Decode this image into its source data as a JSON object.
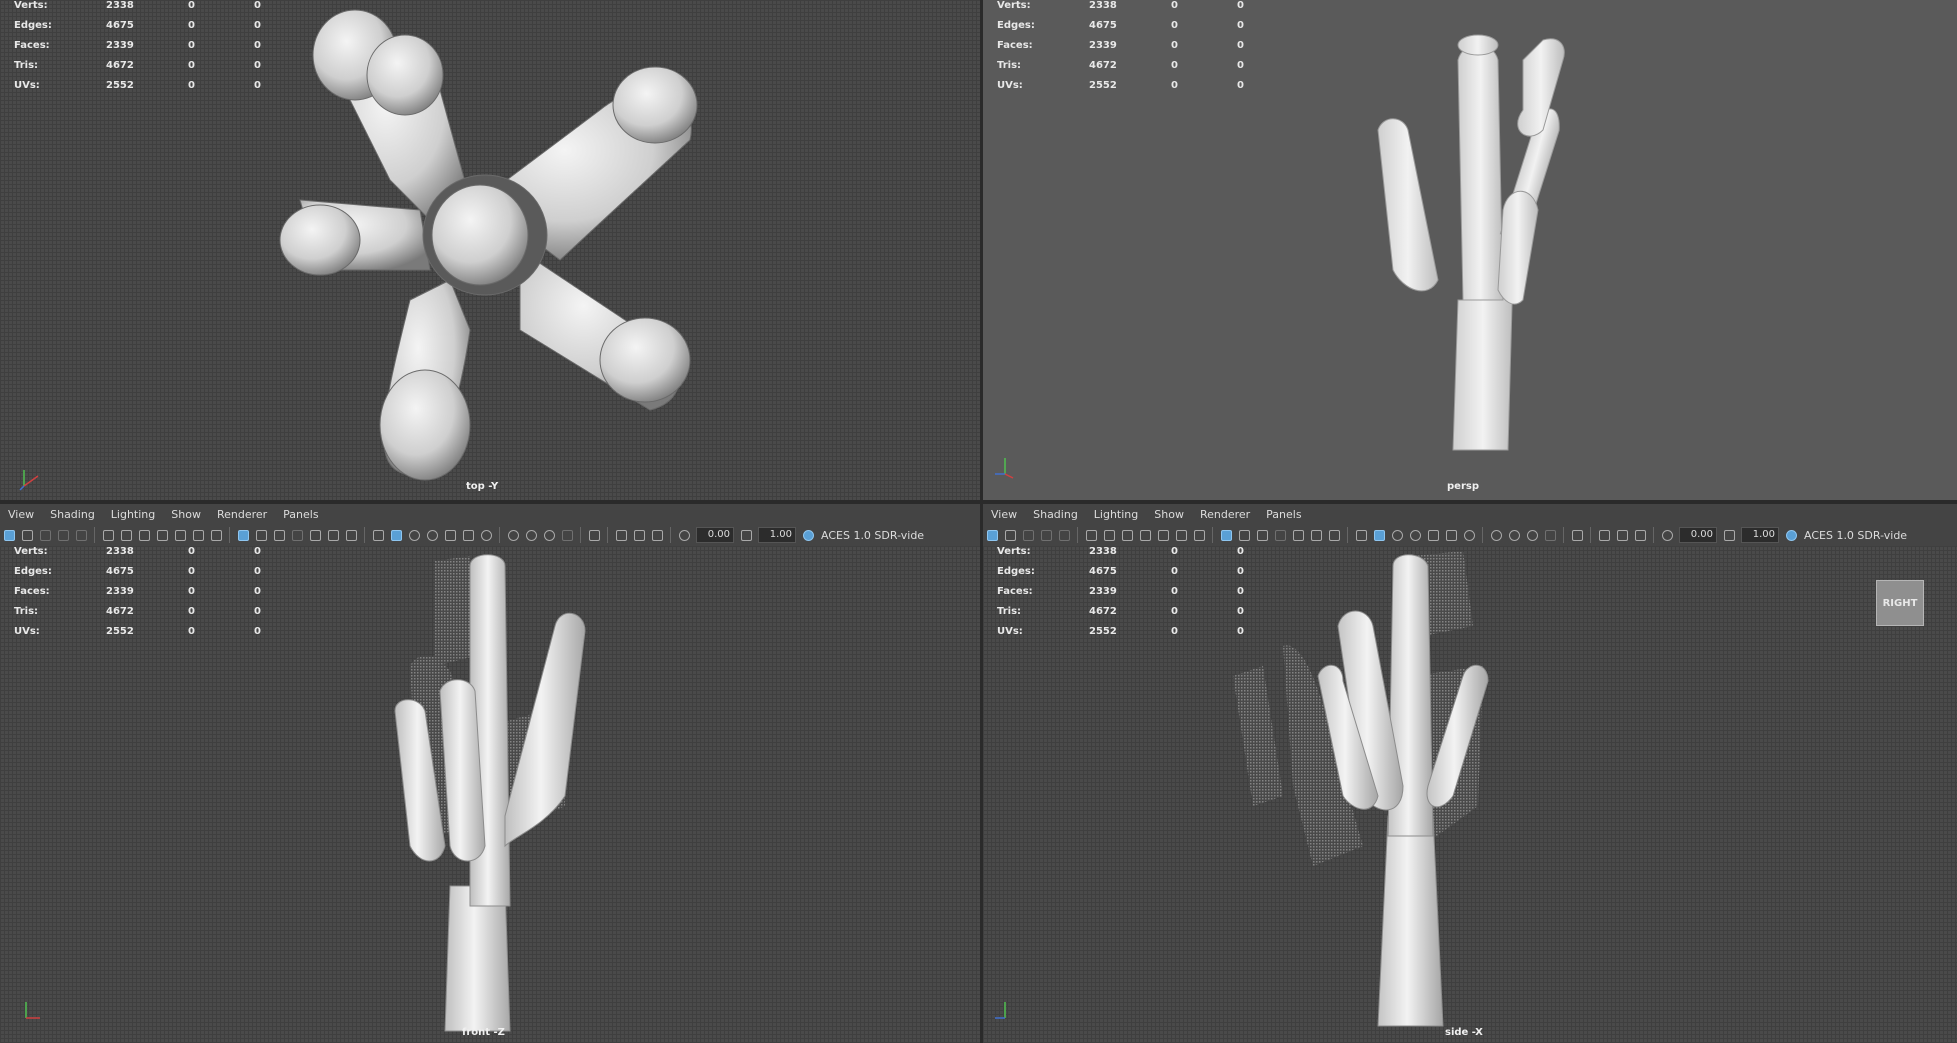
{
  "hud_stats": [
    {
      "label": "Verts:",
      "values": [
        "2338",
        "0",
        "0"
      ]
    },
    {
      "label": "Edges:",
      "values": [
        "4675",
        "0",
        "0"
      ]
    },
    {
      "label": "Faces:",
      "values": [
        "2339",
        "0",
        "0"
      ]
    },
    {
      "label": "Tris:",
      "values": [
        "4672",
        "0",
        "0"
      ]
    },
    {
      "label": "UVs:",
      "values": [
        "2552",
        "0",
        "0"
      ]
    }
  ],
  "viewports": {
    "top": {
      "camera": "top -Y"
    },
    "persp": {
      "camera": "persp"
    },
    "front": {
      "camera": "front -Z"
    },
    "side": {
      "camera": "side -X"
    }
  },
  "panel_menu": [
    "View",
    "Shading",
    "Lighting",
    "Show",
    "Renderer",
    "Panels"
  ],
  "toolbar": {
    "exposure": "0.00",
    "gamma": "1.00",
    "color_space": "ACES 1.0 SDR-vide"
  },
  "viewcube_label": "RIGHT",
  "colors": {
    "grid_bg": "#4a4a4a",
    "persp_bg": "#5a5a5a",
    "toolbar_active": "#5aa0d6",
    "model": "#d9d9d9"
  }
}
